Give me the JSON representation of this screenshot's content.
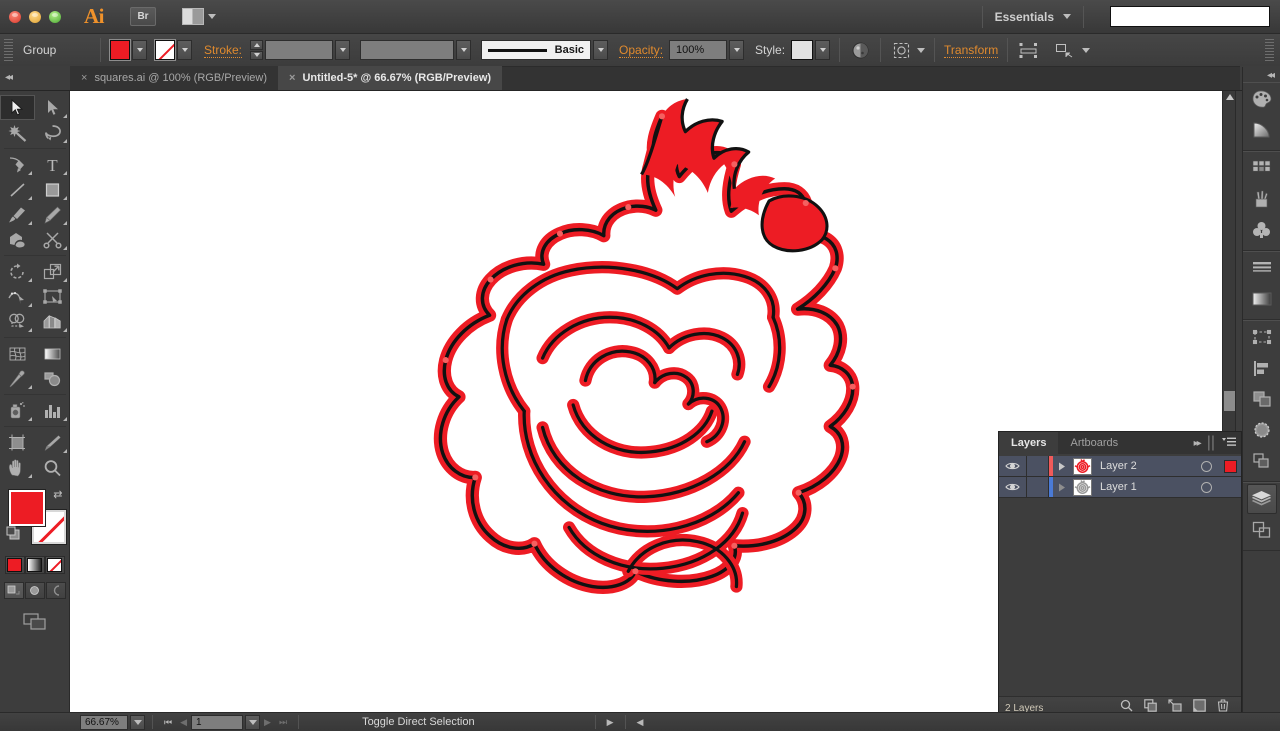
{
  "app": {
    "name": "Adobe Illustrator",
    "logo_text": "Ai",
    "bridge_label": "Br",
    "workspace": "Essentials",
    "search_placeholder": ""
  },
  "window_controls": {
    "close": "close-button",
    "minimize": "minimize-button",
    "zoom": "zoom-button"
  },
  "control_bar": {
    "selection_label": "Group",
    "fill_color": "#ed1c24",
    "stroke_color": "none",
    "stroke_label": "Stroke:",
    "stroke_weight": "",
    "stroke_profile": "",
    "brush_label": "Basic",
    "opacity_label": "Opacity:",
    "opacity_value": "100%",
    "style_label": "Style:",
    "transform_label": "Transform",
    "icons": [
      "opacity-mask-icon",
      "align-icon",
      "isolate-icon",
      "arrange-icon"
    ]
  },
  "tabs": [
    {
      "title": "squares.ai @ 100% (RGB/Preview)",
      "active": false,
      "close": "×"
    },
    {
      "title": "Untitled-5* @ 66.67% (RGB/Preview)",
      "active": true,
      "close": "×"
    }
  ],
  "toolbar": {
    "tools": [
      {
        "name": "selection-tool",
        "icon": "cursor-arrow",
        "selected": true,
        "has_flyout": false
      },
      {
        "name": "direct-selection-tool",
        "icon": "white-arrow",
        "selected": false,
        "has_flyout": true
      },
      {
        "name": "magic-wand-tool",
        "icon": "magic-wand",
        "selected": false,
        "has_flyout": false
      },
      {
        "name": "lasso-tool",
        "icon": "lasso",
        "selected": false,
        "has_flyout": false
      },
      {
        "name": "pen-tool",
        "icon": "pen-nib",
        "selected": false,
        "has_flyout": true
      },
      {
        "name": "type-tool",
        "icon": "type-T",
        "selected": false,
        "has_flyout": true
      },
      {
        "name": "line-segment-tool",
        "icon": "line-diagonal",
        "selected": false,
        "has_flyout": true
      },
      {
        "name": "rectangle-tool",
        "icon": "rectangle",
        "selected": false,
        "has_flyout": true
      },
      {
        "name": "paintbrush-tool",
        "icon": "paintbrush",
        "selected": false,
        "has_flyout": true
      },
      {
        "name": "pencil-tool",
        "icon": "pencil",
        "selected": false,
        "has_flyout": true
      },
      {
        "name": "blob-brush-tool",
        "icon": "blob-brush",
        "selected": false,
        "has_flyout": false
      },
      {
        "name": "eraser-tool",
        "icon": "scissors",
        "selected": false,
        "has_flyout": true
      },
      {
        "name": "rotate-tool",
        "icon": "rotate",
        "selected": false,
        "has_flyout": true
      },
      {
        "name": "scale-tool",
        "icon": "scale",
        "selected": false,
        "has_flyout": true
      },
      {
        "name": "width-tool",
        "icon": "width-warp",
        "selected": false,
        "has_flyout": true
      },
      {
        "name": "free-transform-tool",
        "icon": "free-transform",
        "selected": false,
        "has_flyout": false
      },
      {
        "name": "shape-builder-tool",
        "icon": "shape-builder",
        "selected": false,
        "has_flyout": true
      },
      {
        "name": "perspective-grid-tool",
        "icon": "perspective-grid",
        "selected": false,
        "has_flyout": true
      },
      {
        "name": "mesh-tool",
        "icon": "mesh",
        "selected": false,
        "has_flyout": false
      },
      {
        "name": "gradient-tool",
        "icon": "gradient",
        "selected": false,
        "has_flyout": false
      },
      {
        "name": "eyedropper-tool",
        "icon": "eyedropper",
        "selected": false,
        "has_flyout": true
      },
      {
        "name": "blend-tool",
        "icon": "blend",
        "selected": false,
        "has_flyout": false
      },
      {
        "name": "symbol-sprayer-tool",
        "icon": "symbol-sprayer",
        "selected": false,
        "has_flyout": true
      },
      {
        "name": "column-graph-tool",
        "icon": "bar-graph",
        "selected": false,
        "has_flyout": true
      },
      {
        "name": "artboard-tool",
        "icon": "artboard",
        "selected": false,
        "has_flyout": false
      },
      {
        "name": "slice-tool",
        "icon": "slice-knife",
        "selected": false,
        "has_flyout": true
      },
      {
        "name": "hand-tool",
        "icon": "hand",
        "selected": false,
        "has_flyout": true
      },
      {
        "name": "zoom-tool",
        "icon": "magnifier",
        "selected": false,
        "has_flyout": false
      }
    ],
    "fill_color": "#ed1c24",
    "stroke_color": "none",
    "color_modes": [
      "color-mode",
      "gradient-mode",
      "none-mode"
    ],
    "draw_modes": [
      "draw-normal",
      "draw-behind",
      "draw-inside"
    ],
    "screen_mode": "change-screen-mode"
  },
  "canvas": {
    "artwork_name": "rose-emblem",
    "artwork_fill": "#ed1c24",
    "artwork_stroke": "#000000",
    "background": "#ffffff"
  },
  "layers_panel": {
    "tabs": [
      {
        "label": "Layers",
        "active": true
      },
      {
        "label": "Artboards",
        "active": false
      }
    ],
    "rows": [
      {
        "name": "Layer 2",
        "visible": true,
        "locked": false,
        "color": "#f05a5a",
        "selected": true,
        "has_target": true,
        "has_selection_box": true
      },
      {
        "name": "Layer 1",
        "visible": true,
        "locked": false,
        "color": "#4a7ad6",
        "selected": false,
        "has_target": true,
        "has_selection_box": false
      }
    ],
    "footer_label": "2 Layers",
    "footer_icons": [
      "locate-object-icon",
      "make-clipping-mask-icon",
      "make-subLayer-icon",
      "new-layer-icon",
      "delete-layer-icon"
    ]
  },
  "dock": {
    "groups": [
      {
        "icons": [
          "color-palette-icon",
          "color-guide-icon"
        ]
      },
      {
        "icons": [
          "swatches-icon",
          "brushes-icon",
          "symbols-icon"
        ]
      },
      {
        "icons": [
          "stroke-icon",
          "gradient-icon"
        ]
      },
      {
        "icons": [
          "transform-icon",
          "align-icon",
          "pathfinder-icon",
          "transparency-icon",
          "appearance-icon"
        ]
      },
      {
        "icons": [
          "layers-icon",
          "artboards-icon"
        ],
        "active_index": 0
      }
    ]
  },
  "status_bar": {
    "zoom_level": "66.67%",
    "page_number": "1",
    "tool_hint": "Toggle Direct Selection",
    "nav_first": "⏮",
    "nav_prev": "◀",
    "nav_next": "▶",
    "nav_last": "⏭"
  }
}
